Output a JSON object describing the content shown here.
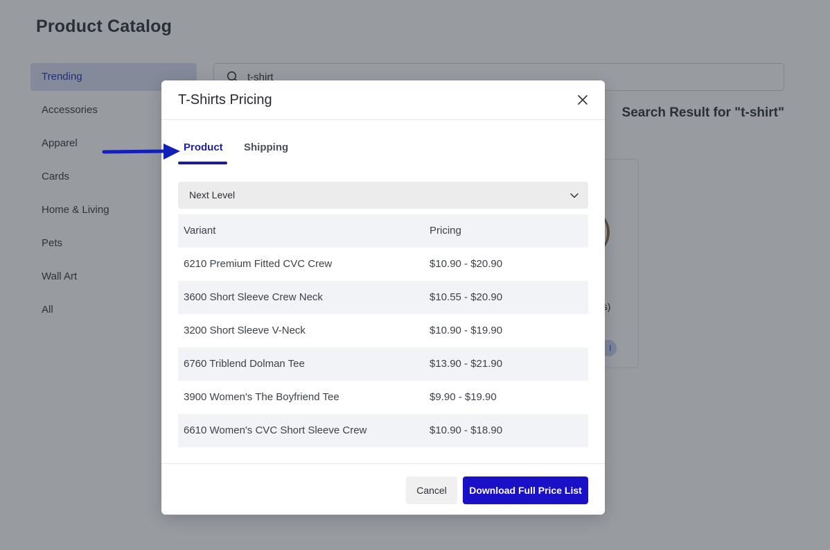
{
  "page": {
    "title": "Product Catalog"
  },
  "sidebar": {
    "items": [
      {
        "label": "Trending",
        "active": true
      },
      {
        "label": "Accessories"
      },
      {
        "label": "Apparel"
      },
      {
        "label": "Cards"
      },
      {
        "label": "Home & Living"
      },
      {
        "label": "Pets"
      },
      {
        "label": "Wall Art"
      },
      {
        "label": "All"
      }
    ]
  },
  "search": {
    "value": "t-shirt",
    "icon": "search-icon"
  },
  "results": {
    "heading": "Search Result for \"t-shirt\"",
    "card_partial_text": "es)",
    "card_partial_pill": "l"
  },
  "modal": {
    "title": "T-Shirts Pricing",
    "close_icon": "close-icon",
    "tabs": [
      {
        "label": "Product",
        "active": true
      },
      {
        "label": "Shipping",
        "active": false
      }
    ],
    "select": {
      "value": "Next Level",
      "icon": "chevron-down-icon"
    },
    "table": {
      "headers": [
        "Variant",
        "Pricing"
      ],
      "rows": [
        {
          "variant": "6210 Premium Fitted CVC Crew",
          "pricing": "$10.90 - $20.90"
        },
        {
          "variant": "3600 Short Sleeve Crew Neck",
          "pricing": "$10.55 - $20.90"
        },
        {
          "variant": "3200 Short Sleeve V-Neck",
          "pricing": "$10.90 - $19.90"
        },
        {
          "variant": "6760 Triblend Dolman Tee",
          "pricing": "$13.90 - $21.90"
        },
        {
          "variant": "3900 Women's The Boyfriend Tee",
          "pricing": "$9.90 - $19.90"
        },
        {
          "variant": "6610 Women's CVC Short Sleeve Crew",
          "pricing": "$10.90 - $18.90"
        }
      ]
    },
    "footer": {
      "cancel_label": "Cancel",
      "download_label": "Download Full Price List"
    }
  },
  "colors": {
    "accent": "#1a10c8",
    "tab_active": "#1d1fa8",
    "sidebar_active_bg": "#d7ddef",
    "overlay": "rgba(40, 48, 58, 0.48)"
  }
}
